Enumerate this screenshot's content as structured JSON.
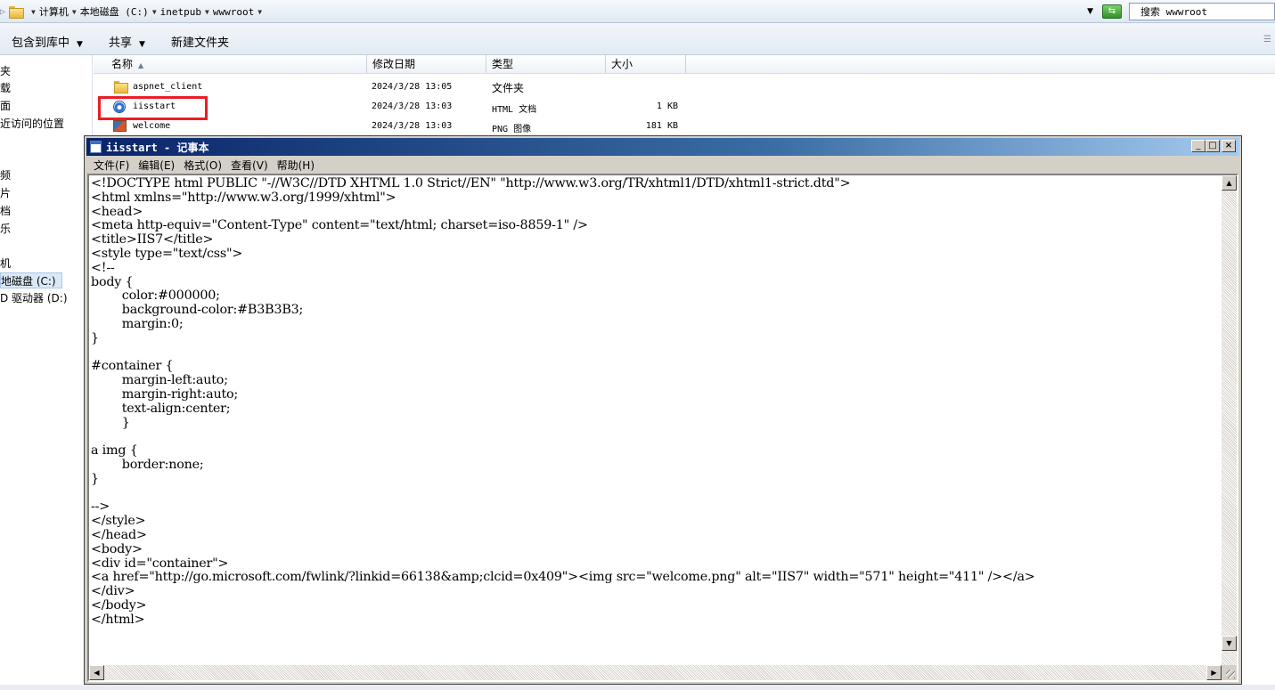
{
  "address_bar": {
    "crumbs": [
      "计算机",
      "本地磁盘 (C:)",
      "inetpub",
      "wwwroot"
    ],
    "search_placeholder": "搜索 wwwroot"
  },
  "toolbar": {
    "include_in_library": "包含到库中",
    "share": "共享",
    "new_folder": "新建文件夹"
  },
  "nav_pane": {
    "items": [
      "夹",
      "载",
      "面",
      "近访问的位置",
      "频",
      "片",
      "档",
      "乐",
      "机",
      "地磁盘 (C:)",
      "D 驱动器 (D:)"
    ]
  },
  "file_list": {
    "columns": [
      "名称",
      "修改日期",
      "类型",
      "大小"
    ],
    "rows": [
      {
        "name": "aspnet_client",
        "date": "2024/3/28 13:05",
        "type": "文件夹",
        "size": "",
        "icon": "folder-icon"
      },
      {
        "name": "iisstart",
        "date": "2024/3/28 13:03",
        "type": "HTML 文档",
        "size": "1 KB",
        "icon": "ie-html-icon"
      },
      {
        "name": "welcome",
        "date": "2024/3/28 13:03",
        "type": "PNG 图像",
        "size": "181 KB",
        "icon": "png-image-icon"
      }
    ]
  },
  "notepad": {
    "title": "iisstart - 记事本",
    "menu": [
      "文件(F)",
      "编辑(E)",
      "格式(O)",
      "查看(V)",
      "帮助(H)"
    ],
    "content": "<!DOCTYPE html PUBLIC \"-//W3C//DTD XHTML 1.0 Strict//EN\" \"http://www.w3.org/TR/xhtml1/DTD/xhtml1-strict.dtd\">\n<html xmlns=\"http://www.w3.org/1999/xhtml\">\n<head>\n<meta http-equiv=\"Content-Type\" content=\"text/html; charset=iso-8859-1\" />\n<title>IIS7</title>\n<style type=\"text/css\">\n<!--\nbody {\n\tcolor:#000000;\n\tbackground-color:#B3B3B3;\n\tmargin:0;\n}\n\n#container {\n\tmargin-left:auto;\n\tmargin-right:auto;\n\ttext-align:center;\n\t}\n\na img {\n\tborder:none;\n}\n\n-->\n</style>\n</head>\n<body>\n<div id=\"container\">\n<a href=\"http://go.microsoft.com/fwlink/?linkid=66138&amp;clcid=0x409\"><img src=\"welcome.png\" alt=\"IIS7\" width=\"571\" height=\"411\" /></a>\n</div>\n</body>\n</html>"
  },
  "colors": {
    "highlight_box": "#ec1c24",
    "title_bar": "#0a246a"
  }
}
